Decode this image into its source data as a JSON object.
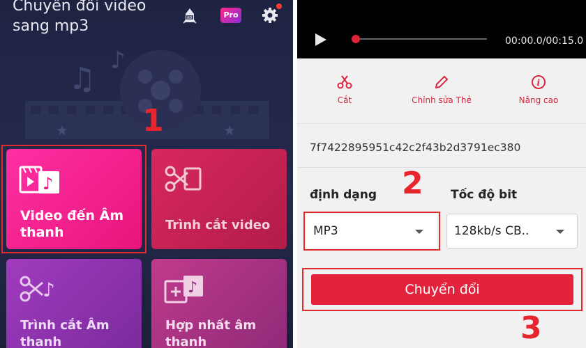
{
  "left": {
    "title": "Chuyển đổi video sang mp3",
    "pro_badge": "Pro",
    "tiles": [
      {
        "label": "Video đến Âm thanh"
      },
      {
        "label": "Trình cắt video"
      },
      {
        "label": "Trình cắt Âm thanh"
      },
      {
        "label": "Hợp nhất âm thanh"
      }
    ],
    "step1": "1"
  },
  "right": {
    "player": {
      "time": "00:00.0/00:15.0",
      "progress": 0.0
    },
    "tools": [
      {
        "label": "Cắt",
        "icon": "scissors-icon"
      },
      {
        "label": "Chỉnh sửa Thẻ",
        "icon": "pencil-icon"
      },
      {
        "label": "Nâng cao",
        "icon": "info-icon"
      }
    ],
    "filename": "7f7422895951c42c2f43b2d3791ec380",
    "format": {
      "label": "định dạng",
      "value": "MP3"
    },
    "bitrate": {
      "label": "Tốc độ bit",
      "value": "128kb/s CB.."
    },
    "convert_label": "Chuyển đổi",
    "step2": "2",
    "step3": "3"
  },
  "colors": {
    "accent": "#e3223c",
    "annotation": "#e8242c",
    "left_bg": "#23284a"
  }
}
